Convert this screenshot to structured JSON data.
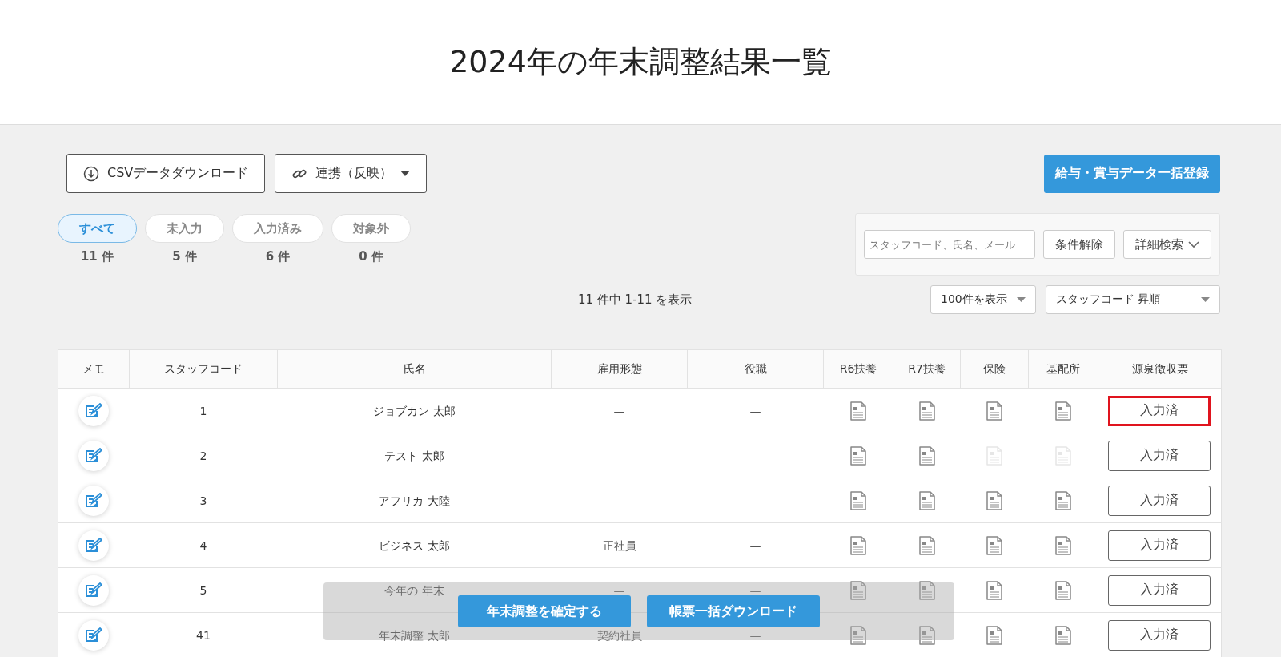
{
  "title": "2024年の年末調整結果一覧",
  "toolbar": {
    "csv_button": "CSVデータダウンロード",
    "link_button": "連携（反映）",
    "bulk_register_button": "給与・賞与データ一括登録"
  },
  "filters": [
    {
      "label": "すべて",
      "count": "11 件",
      "selected": true
    },
    {
      "label": "未入力",
      "count": "5 件",
      "selected": false
    },
    {
      "label": "入力済み",
      "count": "6 件",
      "selected": false
    },
    {
      "label": "対象外",
      "count": "0 件",
      "selected": false
    }
  ],
  "search": {
    "placeholder": "スタッフコード、氏名、メール",
    "clear_button": "条件解除",
    "advanced_button": "詳細検索"
  },
  "result_summary": "11 件中 1-11 を表示",
  "page_size_select": "100件を表示",
  "sort_select": "スタッフコード 昇順",
  "table": {
    "columns": [
      "メモ",
      "スタッフコード",
      "氏名",
      "雇用形態",
      "役職",
      "R6扶養",
      "R7扶養",
      "保険",
      "基配所",
      "源泉徴収票"
    ],
    "rows": [
      {
        "code": "1",
        "name": "ジョブカン 太郎",
        "employment": "—",
        "position": "—",
        "documents": [
          {
            "available": true
          },
          {
            "available": true
          },
          {
            "available": true
          },
          {
            "available": true
          }
        ],
        "status": "入力済",
        "highlighted": true
      },
      {
        "code": "2",
        "name": "テスト 太郎",
        "employment": "—",
        "position": "—",
        "documents": [
          {
            "available": true
          },
          {
            "available": true
          },
          {
            "available": false
          },
          {
            "available": false
          }
        ],
        "status": "入力済",
        "highlighted": false
      },
      {
        "code": "3",
        "name": "アフリカ 大陸",
        "employment": "—",
        "position": "—",
        "documents": [
          {
            "available": true
          },
          {
            "available": true
          },
          {
            "available": true
          },
          {
            "available": true
          }
        ],
        "status": "入力済",
        "highlighted": false
      },
      {
        "code": "4",
        "name": "ビジネス 太郎",
        "employment": "正社員",
        "position": "—",
        "documents": [
          {
            "available": true
          },
          {
            "available": true
          },
          {
            "available": true
          },
          {
            "available": true
          }
        ],
        "status": "入力済",
        "highlighted": false
      },
      {
        "code": "5",
        "name": "今年の 年末",
        "employment": "—",
        "position": "—",
        "documents": [
          {
            "available": true
          },
          {
            "available": true
          },
          {
            "available": true
          },
          {
            "available": true
          }
        ],
        "status": "入力済",
        "highlighted": false
      },
      {
        "code": "41",
        "name": "年末調整 太郎",
        "employment": "契約社員",
        "position": "—",
        "documents": [
          {
            "available": true
          },
          {
            "available": true
          },
          {
            "available": true
          },
          {
            "available": true
          }
        ],
        "status": "入力済",
        "highlighted": false
      }
    ]
  },
  "action_bar": {
    "confirm_button": "年末調整を確定する",
    "download_button": "帳票一括ダウンロード"
  }
}
